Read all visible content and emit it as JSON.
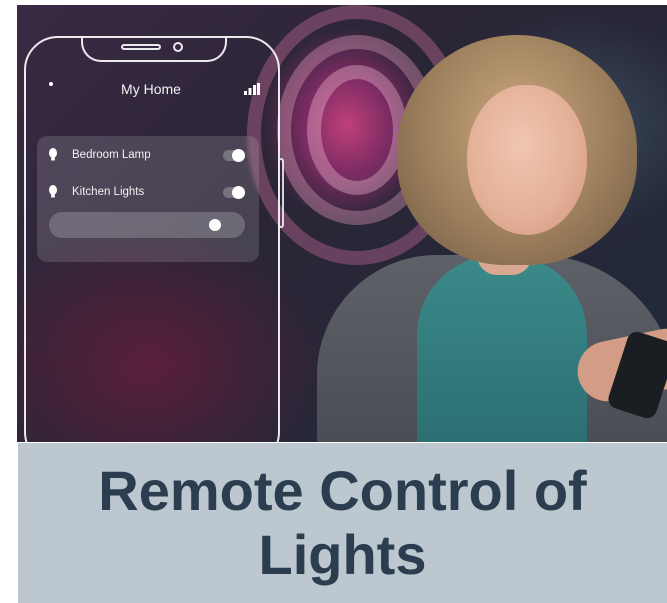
{
  "phone": {
    "title": "My Home",
    "icons": {
      "menu": "dot-icon",
      "signal": "signal-bars-icon",
      "bulb": "lightbulb-icon"
    },
    "devices": [
      {
        "label": "Bedroom Lamp",
        "on": true
      },
      {
        "label": "Kitchen Lights",
        "on": true
      }
    ],
    "brightness_fraction": 0.9
  },
  "caption": {
    "text": "Remote Control of Lights"
  },
  "colors": {
    "caption_bg": "#bcc7cf",
    "caption_text": "#2b3d4f",
    "phone_outline": "#ffffff"
  }
}
